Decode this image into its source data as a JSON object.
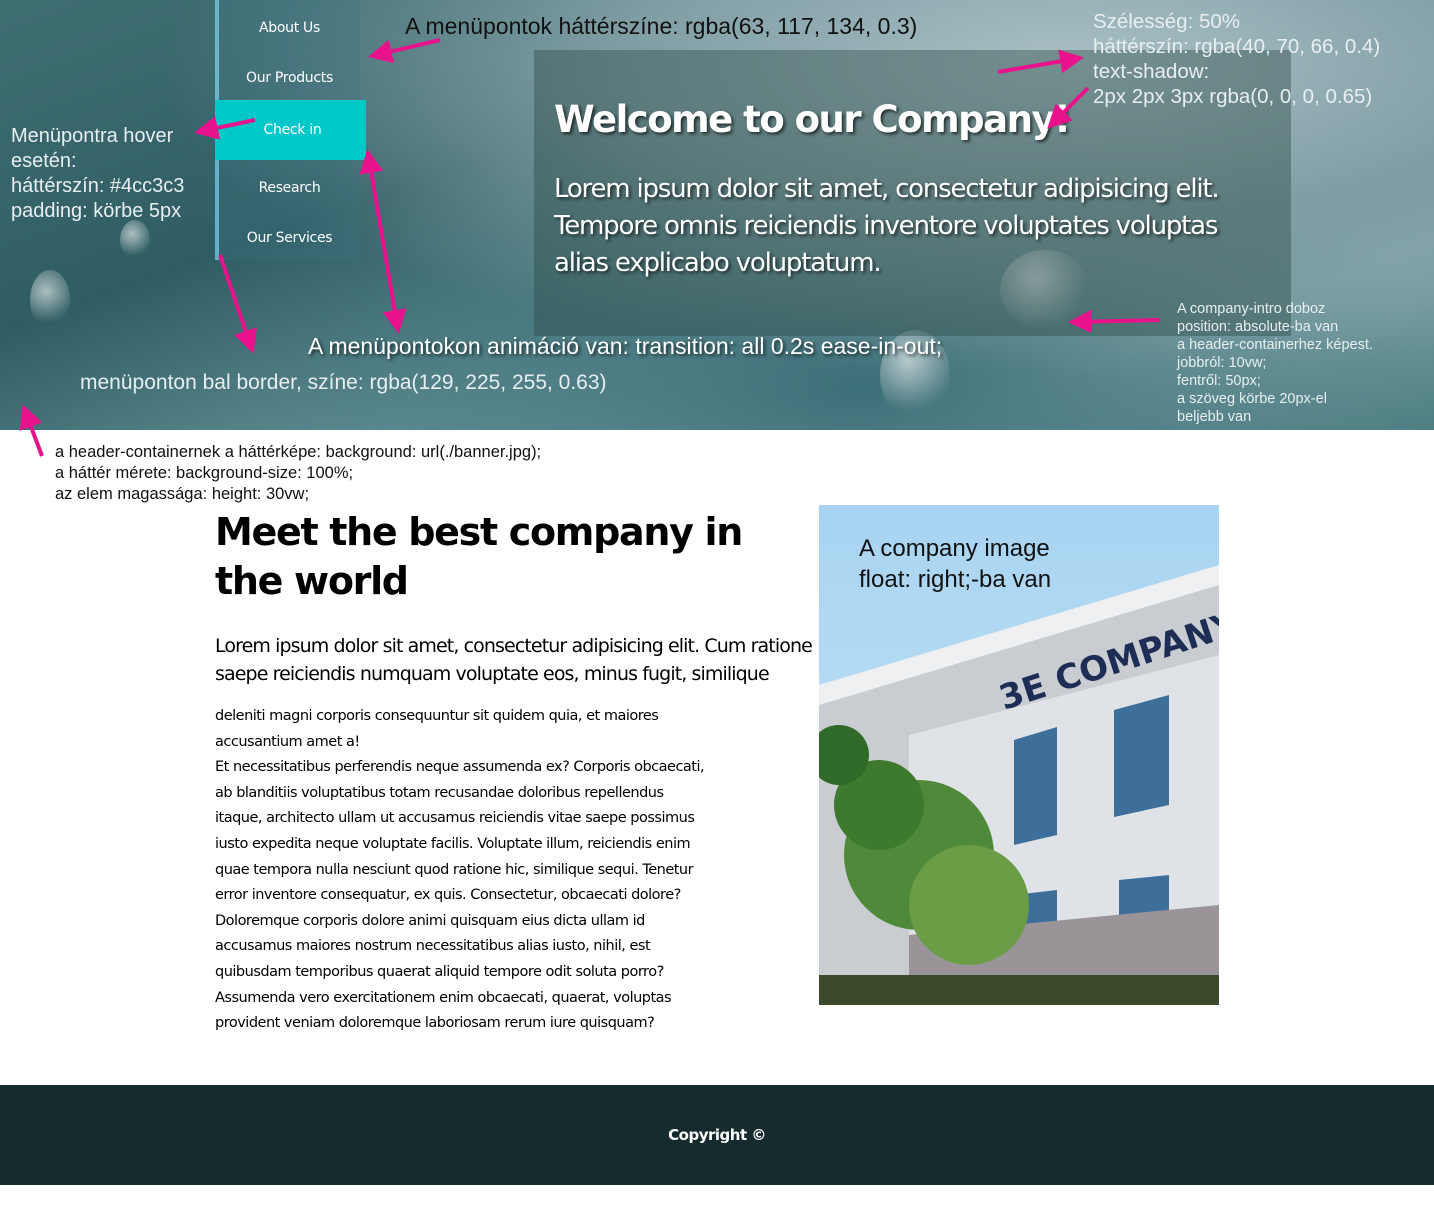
{
  "nav": {
    "items": [
      {
        "label": "About Us"
      },
      {
        "label": "Our Products"
      },
      {
        "label": "Check in",
        "state": "hover"
      },
      {
        "label": "Research"
      },
      {
        "label": "Our Services"
      }
    ]
  },
  "intro": {
    "title": "Welcome to our Company!",
    "text": "Lorem ipsum dolor sit amet, consectetur adipisicing elit. Tempore omnis reiciendis inventore voluptates voluptas alias explicabo voluptatum."
  },
  "annotations": {
    "menu_bg": "A menüpontok háttérszíne: rgba(63, 117, 134, 0.3)",
    "intro_style": "Szélesség: 50%\nháttérszín: rgba(40, 70, 66, 0.4)\ntext-shadow:\n2px 2px 3px rgba(0, 0, 0, 0.65)",
    "hover": "Menüpontra hover\nesetén:\nháttérszín: #4cc3c3\npadding: körbe 5px",
    "transition": "A menüpontokon animáció van: transition: all 0.2s ease-in-out;",
    "border": "menüponton bal border, színe: rgba(129, 225, 255, 0.63)",
    "intro_position": "A company-intro doboz\nposition: absolute-ba van\na header-containerhez képest.\njobbról: 10vw;\nfentről: 50px;\na szöveg körbe 20px-el\nbeljebb van",
    "header_bg": "a header-containernek a háttérképe: background: url(./banner.jpg);\na háttér mérete: background-size: 100%;\naz elem magassága: height: 30vw;",
    "image": "A company image\nfloat: right;-ba van"
  },
  "main": {
    "title": "Meet the best company in the world",
    "lead": "Lorem ipsum dolor sit amet, consectetur adipisicing elit. Cum ratione saepe reiciendis numquam voluptate eos, minus fugit, similique",
    "body": "deleniti magni corporis consequuntur sit quidem quia, et maiores\naccusantium amet a!\nEt necessitatibus perferendis neque assumenda ex? Corporis obcaecati,\nab blanditiis voluptatibus totam recusandae doloribus repellendus\nitaque, architecto ullam ut accusamus reiciendis vitae saepe possimus\niusto expedita neque voluptate facilis. Voluptate illum, reiciendis enim\nquae tempora nulla nesciunt quod ratione hic, similique sequi. Tenetur\nerror inventore consequatur, ex quis. Consectetur, obcaecati dolore?\nDoloremque corporis dolore animi quisquam eius dicta ullam id\naccusamus maiores nostrum necessitatibus alias iusto, nihil, est\nquibusdam temporibus quaerat aliquid tempore odit soluta porro?\nAssumenda vero exercitationem enim obcaecati, quaerat, voluptas\nprovident veniam doloremque laboriosam rerum iure quisquam?",
    "building_sign": "3E COMPANY"
  },
  "footer": {
    "text": "Copyright ©"
  },
  "colors": {
    "arrow": "#e8128c",
    "hover": "#00c8c8",
    "footer": "#162b2e",
    "nav_border": "rgba(129,225,255,0.63)"
  }
}
